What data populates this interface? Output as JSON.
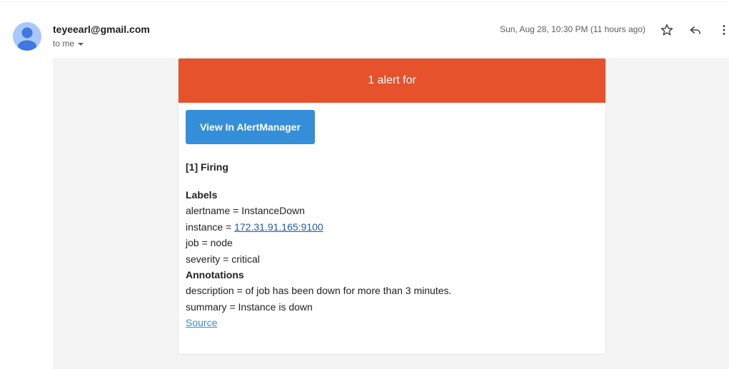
{
  "sender": {
    "email": "teyeearl@gmail.com",
    "recipient_label": "to me"
  },
  "header": {
    "timestamp": "Sun, Aug 28, 10:30 PM (11 hours ago)",
    "icons": [
      "star-icon",
      "reply-icon",
      "more-vert-icon"
    ]
  },
  "alert": {
    "banner_title": "1 alert for",
    "banner_color": "#e6522c",
    "button_label": "View In AlertManager",
    "button_color": "#348eda",
    "firing_title": "[1] Firing",
    "labels_title": "Labels",
    "labels": {
      "alertname": "alertname = InstanceDown",
      "instance_prefix": "instance = ",
      "instance_link": "172.31.91.165:9100",
      "job": "job = node",
      "severity": "severity = critical"
    },
    "annotations_title": "Annotations",
    "annotations": {
      "description": "description = of job has been down for more than 3 minutes.",
      "summary": "summary = Instance is down"
    },
    "source_label": "Source"
  }
}
